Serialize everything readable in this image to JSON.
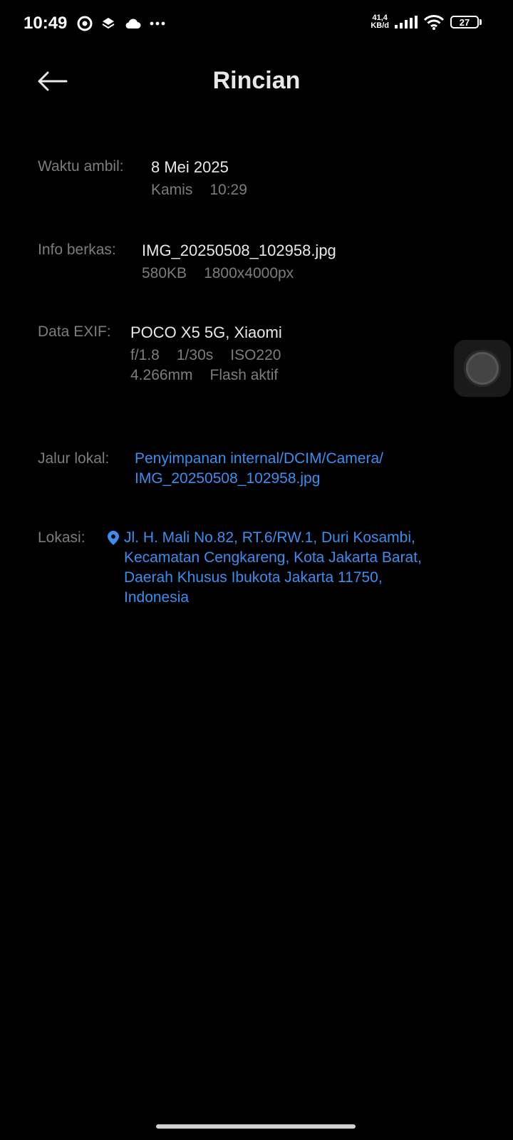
{
  "status_bar": {
    "time": "10:49",
    "net_speed_value": "41,4",
    "net_speed_unit": "KB/d",
    "battery": "27",
    "icons": [
      "location-pin-icon",
      "layers-icon",
      "cloud-icon",
      "more-dots-icon",
      "signal-icon",
      "wifi-icon",
      "battery-icon"
    ]
  },
  "header": {
    "title": "Rincian",
    "back_icon": "back-arrow-icon"
  },
  "details": {
    "taken": {
      "label": "Waktu ambil:",
      "date": "8 Mei 2025",
      "day": "Kamis",
      "time": "10:29"
    },
    "file": {
      "label": "Info berkas:",
      "name": "IMG_20250508_102958.jpg",
      "size": "580KB",
      "resolution": "1800x4000px"
    },
    "exif": {
      "label": "Data EXIF:",
      "device": "POCO X5 5G, Xiaomi",
      "aperture": "f/1.8",
      "shutter": "1/30s",
      "iso": "ISO220",
      "focal_length": "4.266mm",
      "flash": "Flash aktif"
    },
    "path": {
      "label": "Jalur lokal:",
      "line1": "Penyimpanan internal/DCIM/Camera/",
      "line2": "IMG_20250508_102958.jpg"
    },
    "location": {
      "label": "Lokasi:",
      "line1": "Jl. H. Mali No.82, RT.6/RW.1, Duri Kosambi,",
      "line2": "Kecamatan Cengkareng, Kota Jakarta Barat,",
      "line3": "Daerah Khusus Ibukota Jakarta 11750,",
      "line4": "Indonesia"
    }
  },
  "colors": {
    "background": "#000000",
    "label": "#7c7c7c",
    "value": "#e8e8e8",
    "link": "#3a8ef0"
  }
}
